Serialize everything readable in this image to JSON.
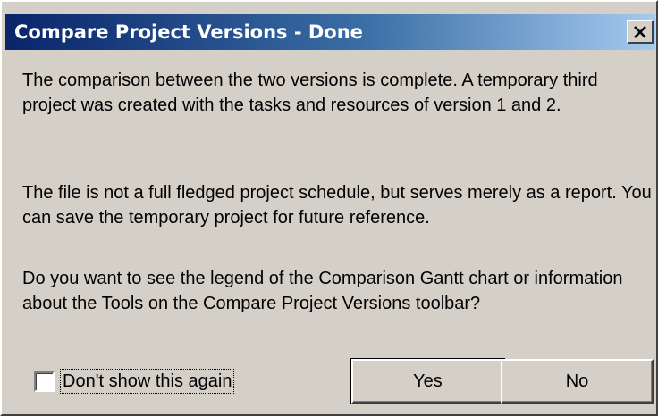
{
  "dialog": {
    "title": "Compare Project Versions - Done",
    "close_icon": "close-x-icon",
    "messages": [
      "The comparison between the two versions is complete. A temporary third project was created with the tasks and resources of version 1 and 2.",
      "The file is not a full fledged project schedule, but serves merely as a report. You can save the temporary project for future reference.",
      "Do you want to see the legend of the Comparison Gantt chart or information about the Tools on the Compare Project Versions toolbar?"
    ],
    "checkbox": {
      "label": "Don't show this again",
      "checked": false
    },
    "buttons": {
      "yes": "Yes",
      "no": "No"
    }
  },
  "colors": {
    "title_gradient_start": "#0a246a",
    "title_gradient_end": "#a6caf0",
    "face": "#d4d0c8"
  }
}
